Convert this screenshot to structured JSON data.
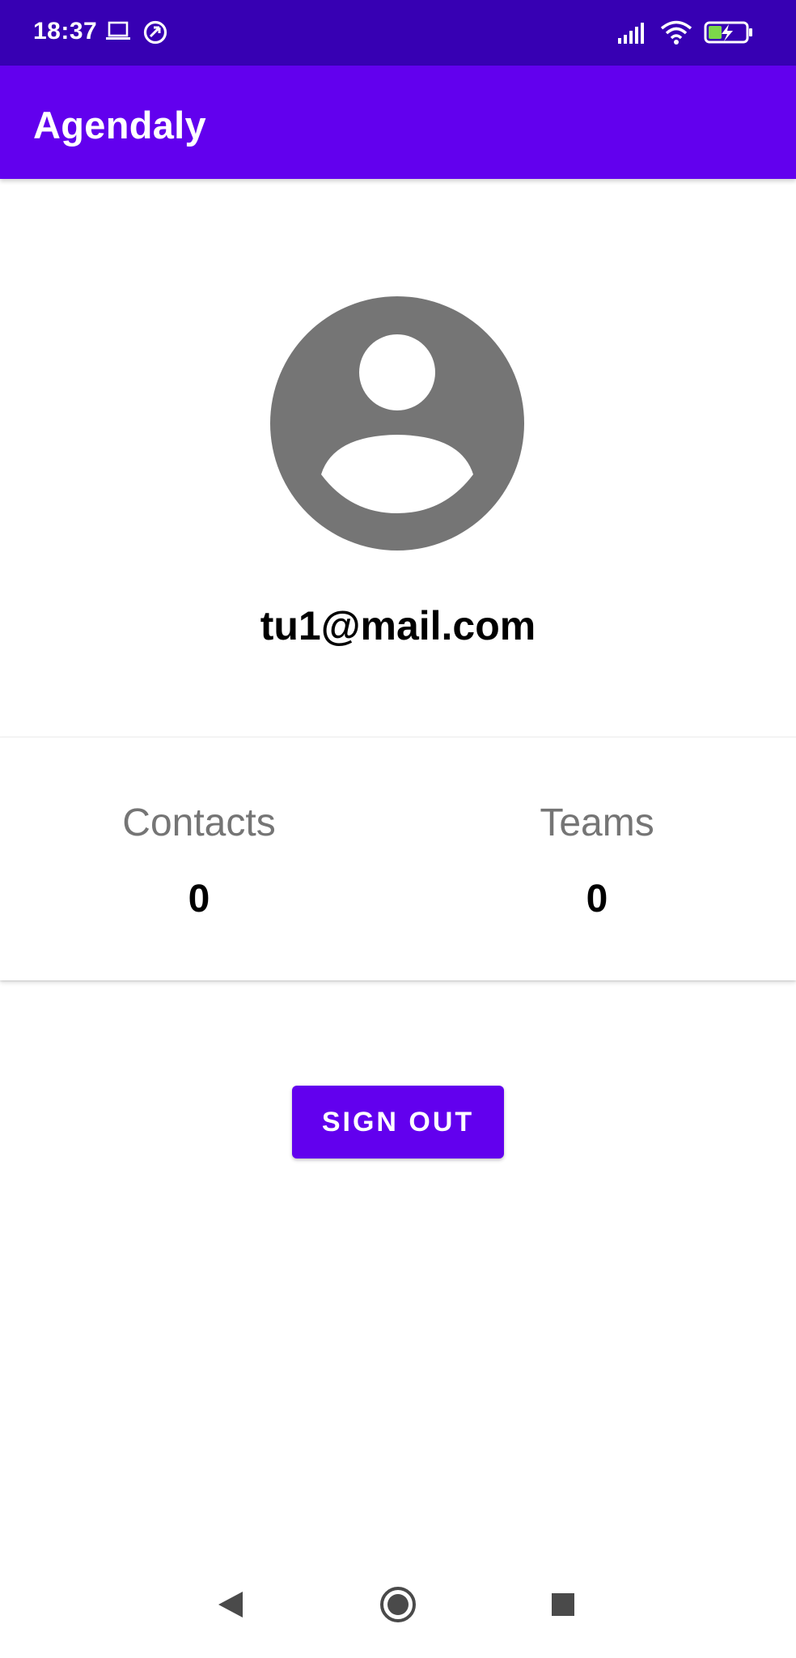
{
  "status_bar": {
    "time": "18:37",
    "icons": [
      "laptop-icon",
      "data-saver-icon",
      "signal-icon",
      "wifi-icon",
      "battery-charging-icon"
    ]
  },
  "app_bar": {
    "title": "Agendaly"
  },
  "profile": {
    "avatar_icon": "account-circle-icon",
    "email": "tu1@mail.com"
  },
  "stats": {
    "contacts": {
      "label": "Contacts",
      "value": "0"
    },
    "teams": {
      "label": "Teams",
      "value": "0"
    }
  },
  "actions": {
    "sign_out_label": "SIGN OUT"
  },
  "nav_bar": {
    "icons": [
      "back-icon",
      "home-icon",
      "recents-icon"
    ]
  },
  "colors": {
    "status_bar": "#3700b3",
    "primary": "#6200ee",
    "avatar_gray": "#757575",
    "label_gray": "#757575"
  }
}
